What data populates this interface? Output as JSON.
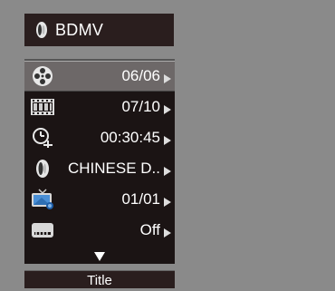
{
  "header": {
    "disc_icon": "audio-disc-icon",
    "disc_type": "BDMV"
  },
  "menu": {
    "items": [
      {
        "icon": "film-reel-icon",
        "value": "06/06",
        "selected": true
      },
      {
        "icon": "filmstrip-chapter-icon",
        "value": "07/10",
        "selected": false
      },
      {
        "icon": "clock-time-icon",
        "value": "00:30:45",
        "selected": false
      },
      {
        "icon": "audio-language-icon",
        "value": "CHINESE D..",
        "selected": false
      },
      {
        "icon": "tv-angle-icon",
        "value": "01/01",
        "selected": false
      },
      {
        "icon": "subtitle-icon",
        "value": "Off",
        "selected": false
      }
    ],
    "more_indicator": "down-arrow-icon"
  },
  "footer": {
    "label": "Title"
  },
  "colors": {
    "background": "#8a8a8a",
    "panel": "#1b1414",
    "selected_row": "#6d6868",
    "text": "#ffffff"
  }
}
